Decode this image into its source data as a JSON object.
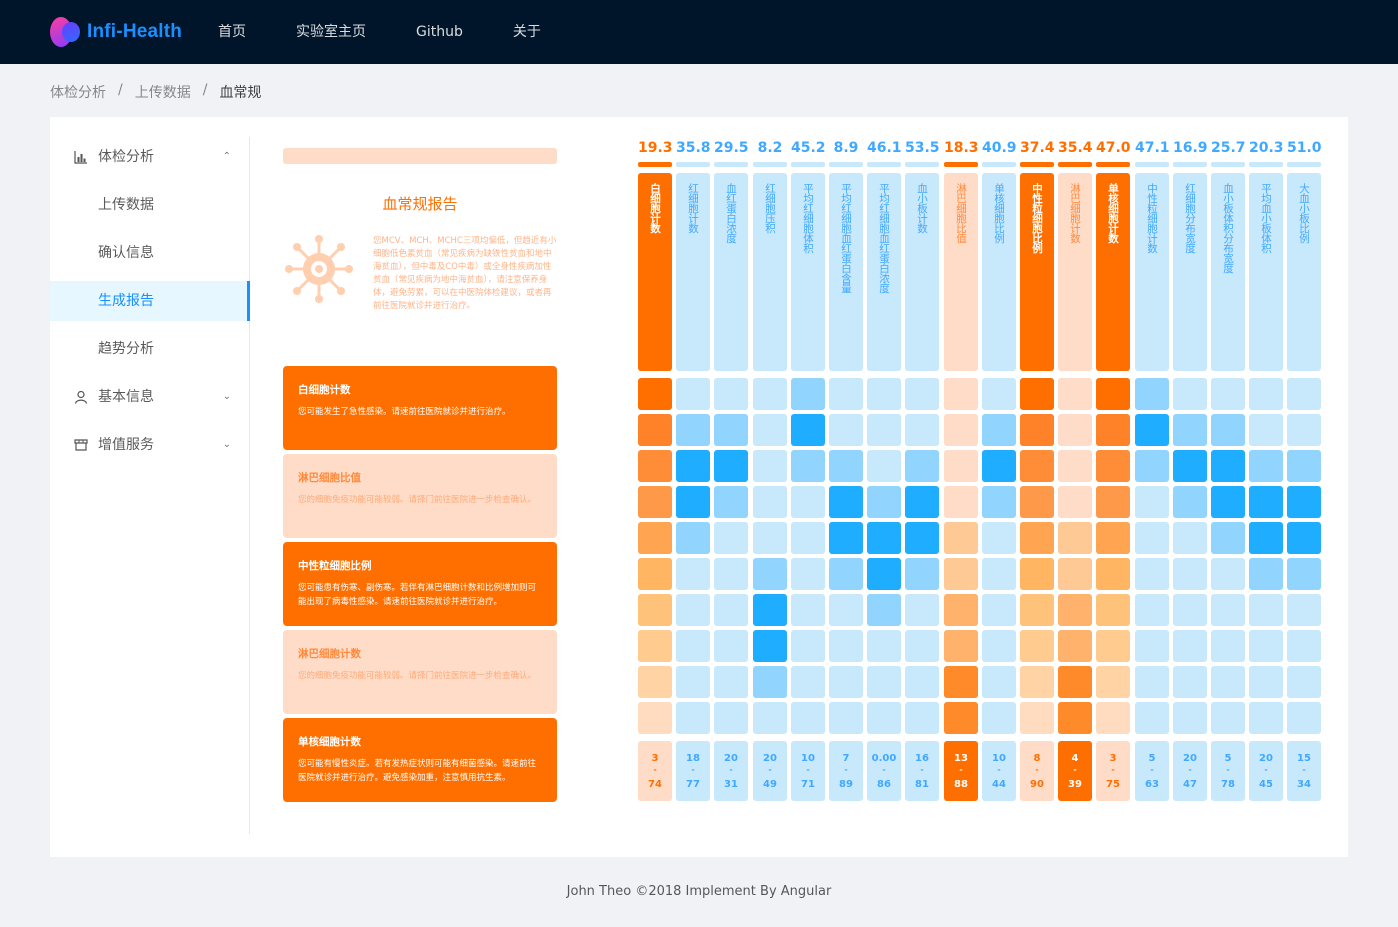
{
  "header": {
    "logo_text": "Infi-Health",
    "nav": [
      "首页",
      "实验室主页",
      "Github",
      "关于"
    ]
  },
  "breadcrumb": [
    "体检分析",
    "上传数据",
    "血常规"
  ],
  "sidebar": {
    "items": [
      {
        "label": "体检分析",
        "icon": "chart-icon",
        "expanded": true
      },
      {
        "label": "上传数据"
      },
      {
        "label": "确认信息"
      },
      {
        "label": "生成报告",
        "active": true
      },
      {
        "label": "趋势分析"
      },
      {
        "label": "基本信息",
        "icon": "user-icon"
      },
      {
        "label": "增值服务",
        "icon": "shop-icon"
      }
    ]
  },
  "report": {
    "title": "血常规报告",
    "description": "您MCV、MCH、MCHC三项均偏低，但趋近有小细胞低色素贫血（常见疾病为缺铁性贫血和地中海贫血），但中毒及CO中毒）或全身性疾病加性贫血（常见疾病为地中海贫血），请注意保养身体，避免劳累，可以在中医院体检建议，或者再前往医院就诊并进行治疗。",
    "cards": [
      {
        "title": "白细胞计数",
        "text": "您可能发生了急性感染。请速前往医院就诊并进行治疗。",
        "style": "strong"
      },
      {
        "title": "淋巴细胞比值",
        "text": "您的细胞免疫功能可能较弱。请择门前往医院进一步检查确认。",
        "style": "light"
      },
      {
        "title": "中性粒细胞比例",
        "text": "您可能患有伤寒、副伤寒。若伴有淋巴细胞计数和比例增加则可能出现了病毒性感染。请速前往医院就诊并进行治疗。",
        "style": "strong"
      },
      {
        "title": "淋巴细胞计数",
        "text": "您的细胞免疫功能可能较弱。请择门前往医院进一步检查确认。",
        "style": "light"
      },
      {
        "title": "单核细胞计数",
        "text": "您可能有慢性炎症。若有发热症状则可能有细菌感染。请速前往医院就诊并进行治疗。避免感染加重，注意慎用抗生素。",
        "style": "strong"
      }
    ]
  },
  "chart_data": {
    "type": "heatmap",
    "columns": [
      {
        "label": "白细胞计数",
        "value": "19.3",
        "min": "3",
        "max": "74",
        "alert": "strong",
        "level": 1.0
      },
      {
        "label": "红细胞计数",
        "value": "35.8",
        "min": "18",
        "max": "77",
        "alert": "none",
        "level": 0.3
      },
      {
        "label": "血红蛋白浓度",
        "value": "29.5",
        "min": "20",
        "max": "31",
        "alert": "none",
        "level": 0.2
      },
      {
        "label": "红细胞压积",
        "value": "8.2",
        "min": "20",
        "max": "49",
        "alert": "none",
        "level": 0.7
      },
      {
        "label": "平均红细胞体积",
        "value": "45.2",
        "min": "10",
        "max": "71",
        "alert": "none",
        "level": 0.1
      },
      {
        "label": "平均红细胞血红蛋白含量",
        "value": "8.9",
        "min": "7",
        "max": "89",
        "alert": "none",
        "level": 0.4
      },
      {
        "label": "平均红细胞血红蛋白浓度",
        "value": "46.1",
        "min": "0.00",
        "max": "86",
        "alert": "none",
        "level": 0.5
      },
      {
        "label": "血小板计数",
        "value": "53.5",
        "min": "16",
        "max": "81",
        "alert": "none",
        "level": 0.4
      },
      {
        "label": "淋巴细胞比值",
        "value": "18.3",
        "min": "13",
        "max": "88",
        "alert": "light",
        "level": 0.9
      },
      {
        "label": "单核细胞比例",
        "value": "40.9",
        "min": "10",
        "max": "44",
        "alert": "none",
        "level": 0.2
      },
      {
        "label": "中性粒细胞比例",
        "value": "37.4",
        "min": "8",
        "max": "90",
        "alert": "strong",
        "level": 0.3
      },
      {
        "label": "淋巴细胞计数",
        "value": "35.4",
        "min": "4",
        "max": "39",
        "alert": "light",
        "level": 0.9
      },
      {
        "label": "单核细胞计数",
        "value": "47.0",
        "min": "3",
        "max": "75",
        "alert": "strong",
        "level": 0.2
      },
      {
        "label": "中性粒细胞计数",
        "value": "47.1",
        "min": "5",
        "max": "63",
        "alert": "none",
        "level": 0.1
      },
      {
        "label": "红细胞分布宽度",
        "value": "16.9",
        "min": "20",
        "max": "47",
        "alert": "none",
        "level": 0.2
      },
      {
        "label": "血小板体积分布宽度",
        "value": "25.7",
        "min": "5",
        "max": "78",
        "alert": "none",
        "level": 0.3
      },
      {
        "label": "平均血小板体积",
        "value": "20.3",
        "min": "20",
        "max": "45",
        "alert": "none",
        "level": 0.4
      },
      {
        "label": "大血小板比例",
        "value": "51.0",
        "min": "15",
        "max": "34",
        "alert": "none",
        "level": 0.4
      }
    ],
    "colors": {
      "strong_orange": "#ff6f00",
      "light_orange": "#ffdcc7",
      "blue_dark": "#1faeff",
      "blue_mid": "#91d5ff",
      "blue_light": "#c8e8fc",
      "value_orange": "#ff6f00",
      "value_blue": "#40a9ff"
    }
  },
  "footer": {
    "text": "John Theo ©2018 Implement By Angular"
  }
}
